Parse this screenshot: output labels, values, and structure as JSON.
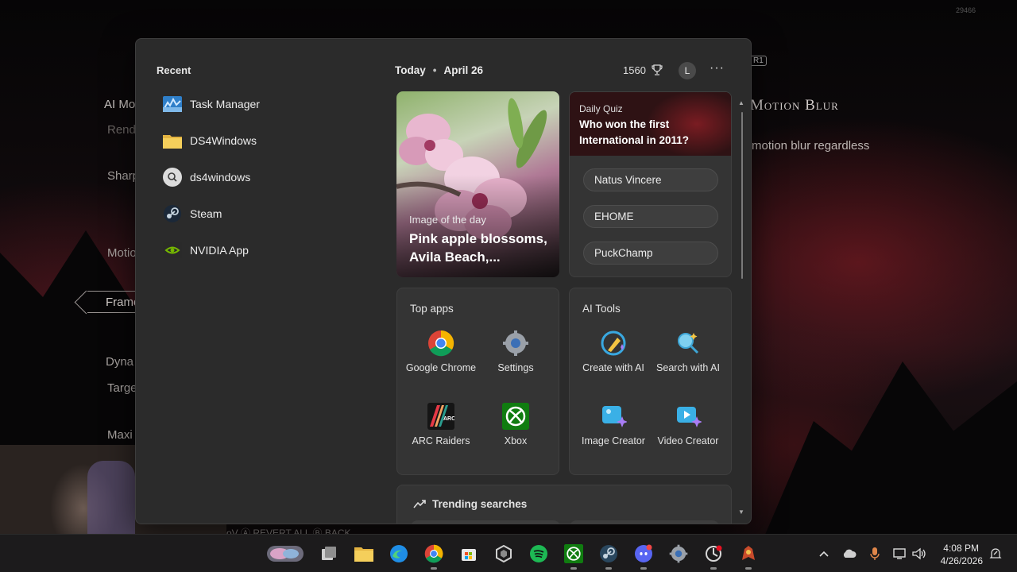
{
  "background": {
    "game_title_right": "Motion Blur",
    "game_desc_right": "motion blur regardless",
    "left_items": [
      "AI Mo",
      "Rend",
      "Sharp",
      "Motio",
      "Frame",
      "Dyna",
      "Targe",
      "Maxi"
    ],
    "watermark": "29466",
    "button_hint": "R1",
    "footer_hints": "oV   Ⓐ REVERT ALL   Ⓑ BACK"
  },
  "recent": {
    "title": "Recent",
    "items": [
      {
        "label": "Task Manager",
        "icon": "task-manager-icon"
      },
      {
        "label": "DS4Windows",
        "icon": "folder-icon"
      },
      {
        "label": "ds4windows",
        "icon": "search-icon"
      },
      {
        "label": "Steam",
        "icon": "steam-icon"
      },
      {
        "label": "NVIDIA App",
        "icon": "nvidia-icon"
      }
    ]
  },
  "header": {
    "today": "Today",
    "date": "April 26",
    "points": "1560",
    "avatar_initial": "L",
    "more": "···"
  },
  "image_of_day": {
    "label": "Image of the day",
    "title": "Pink apple blossoms, Avila Beach,..."
  },
  "quiz": {
    "kicker": "Daily Quiz",
    "question": "Who won the first International in 2011?",
    "options": [
      "Natus Vincere",
      "EHOME",
      "PuckChamp"
    ]
  },
  "top_apps": {
    "title": "Top apps",
    "apps": [
      {
        "label": "Google Chrome",
        "icon": "chrome-icon"
      },
      {
        "label": "Settings",
        "icon": "settings-icon"
      },
      {
        "label": "ARC Raiders",
        "icon": "arc-raiders-icon"
      },
      {
        "label": "Xbox",
        "icon": "xbox-icon"
      }
    ]
  },
  "ai_tools": {
    "title": "AI Tools",
    "tools": [
      {
        "label": "Create with AI",
        "icon": "create-ai-icon"
      },
      {
        "label": "Search with AI",
        "icon": "search-ai-icon"
      },
      {
        "label": "Image Creator",
        "icon": "image-creator-icon"
      },
      {
        "label": "Video Creator",
        "icon": "video-creator-icon"
      }
    ]
  },
  "trending": {
    "title": "Trending searches"
  },
  "taskbar": {
    "time": "4:08 PM",
    "date": "4/26/2026"
  },
  "colors": {
    "panel_bg": "#2b2b2b",
    "card_bg": "#343434",
    "taskbar_bg": "#1c1b1c",
    "background_red": "#8c1d26"
  }
}
